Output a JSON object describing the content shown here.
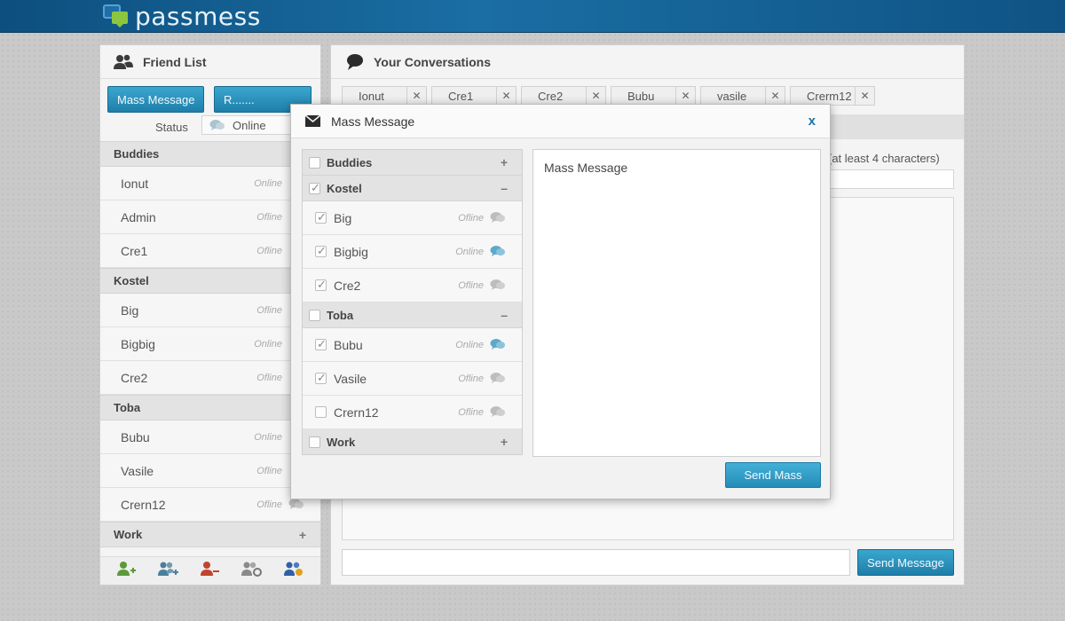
{
  "app": {
    "name": "passmess"
  },
  "friend_list": {
    "title": "Friend List",
    "mass_message_label": "Mass Message",
    "second_button_label": "R.......",
    "status_label": "Status",
    "status_value": "Online",
    "groups": [
      {
        "name": "Buddies",
        "friends": [
          {
            "name": "Ionut",
            "status": "Online"
          },
          {
            "name": "Admin",
            "status": "Ofline"
          },
          {
            "name": "Cre1",
            "status": "Ofline"
          }
        ]
      },
      {
        "name": "Kostel",
        "friends": [
          {
            "name": "Big",
            "status": "Ofline"
          },
          {
            "name": "Bigbig",
            "status": "Online"
          },
          {
            "name": "Cre2",
            "status": "Ofline"
          }
        ]
      },
      {
        "name": "Toba",
        "friends": [
          {
            "name": "Bubu",
            "status": "Online"
          },
          {
            "name": "Vasile",
            "status": "Ofline"
          },
          {
            "name": "Crern12",
            "status": "Ofline"
          }
        ]
      },
      {
        "name": "Work",
        "sign": "+"
      }
    ]
  },
  "conversations": {
    "title": "Your Conversations",
    "tabs": [
      "Ionut",
      "Cre1",
      "Cre2",
      "Bubu",
      "vasile",
      "Crerm12"
    ],
    "topic_hint": "(at least 4 characters)",
    "send_label": "Send Message"
  },
  "modal": {
    "title": "Mass Message",
    "close_label": "x",
    "message": "Mass Message",
    "send_label": "Send Mass",
    "groups": [
      {
        "name": "Buddies",
        "checked": false,
        "sign": "+",
        "items": []
      },
      {
        "name": "Kostel",
        "checked": true,
        "sign": "–",
        "items": [
          {
            "name": "Big",
            "status": "Ofline",
            "checked": true
          },
          {
            "name": "Bigbig",
            "status": "Online",
            "checked": true
          },
          {
            "name": "Cre2",
            "status": "Ofline",
            "checked": true
          }
        ]
      },
      {
        "name": "Toba",
        "checked": false,
        "sign": "–",
        "items": [
          {
            "name": "Bubu",
            "status": "Online",
            "checked": true
          },
          {
            "name": "Vasile",
            "status": "Ofline",
            "checked": true
          },
          {
            "name": "Crern12",
            "status": "Ofline",
            "checked": false
          }
        ]
      },
      {
        "name": "Work",
        "checked": false,
        "sign": "+",
        "items": []
      }
    ]
  },
  "icons": {
    "online_chat_color": "#5fa9c8",
    "offline_chat_color": "#bdbdbd"
  }
}
